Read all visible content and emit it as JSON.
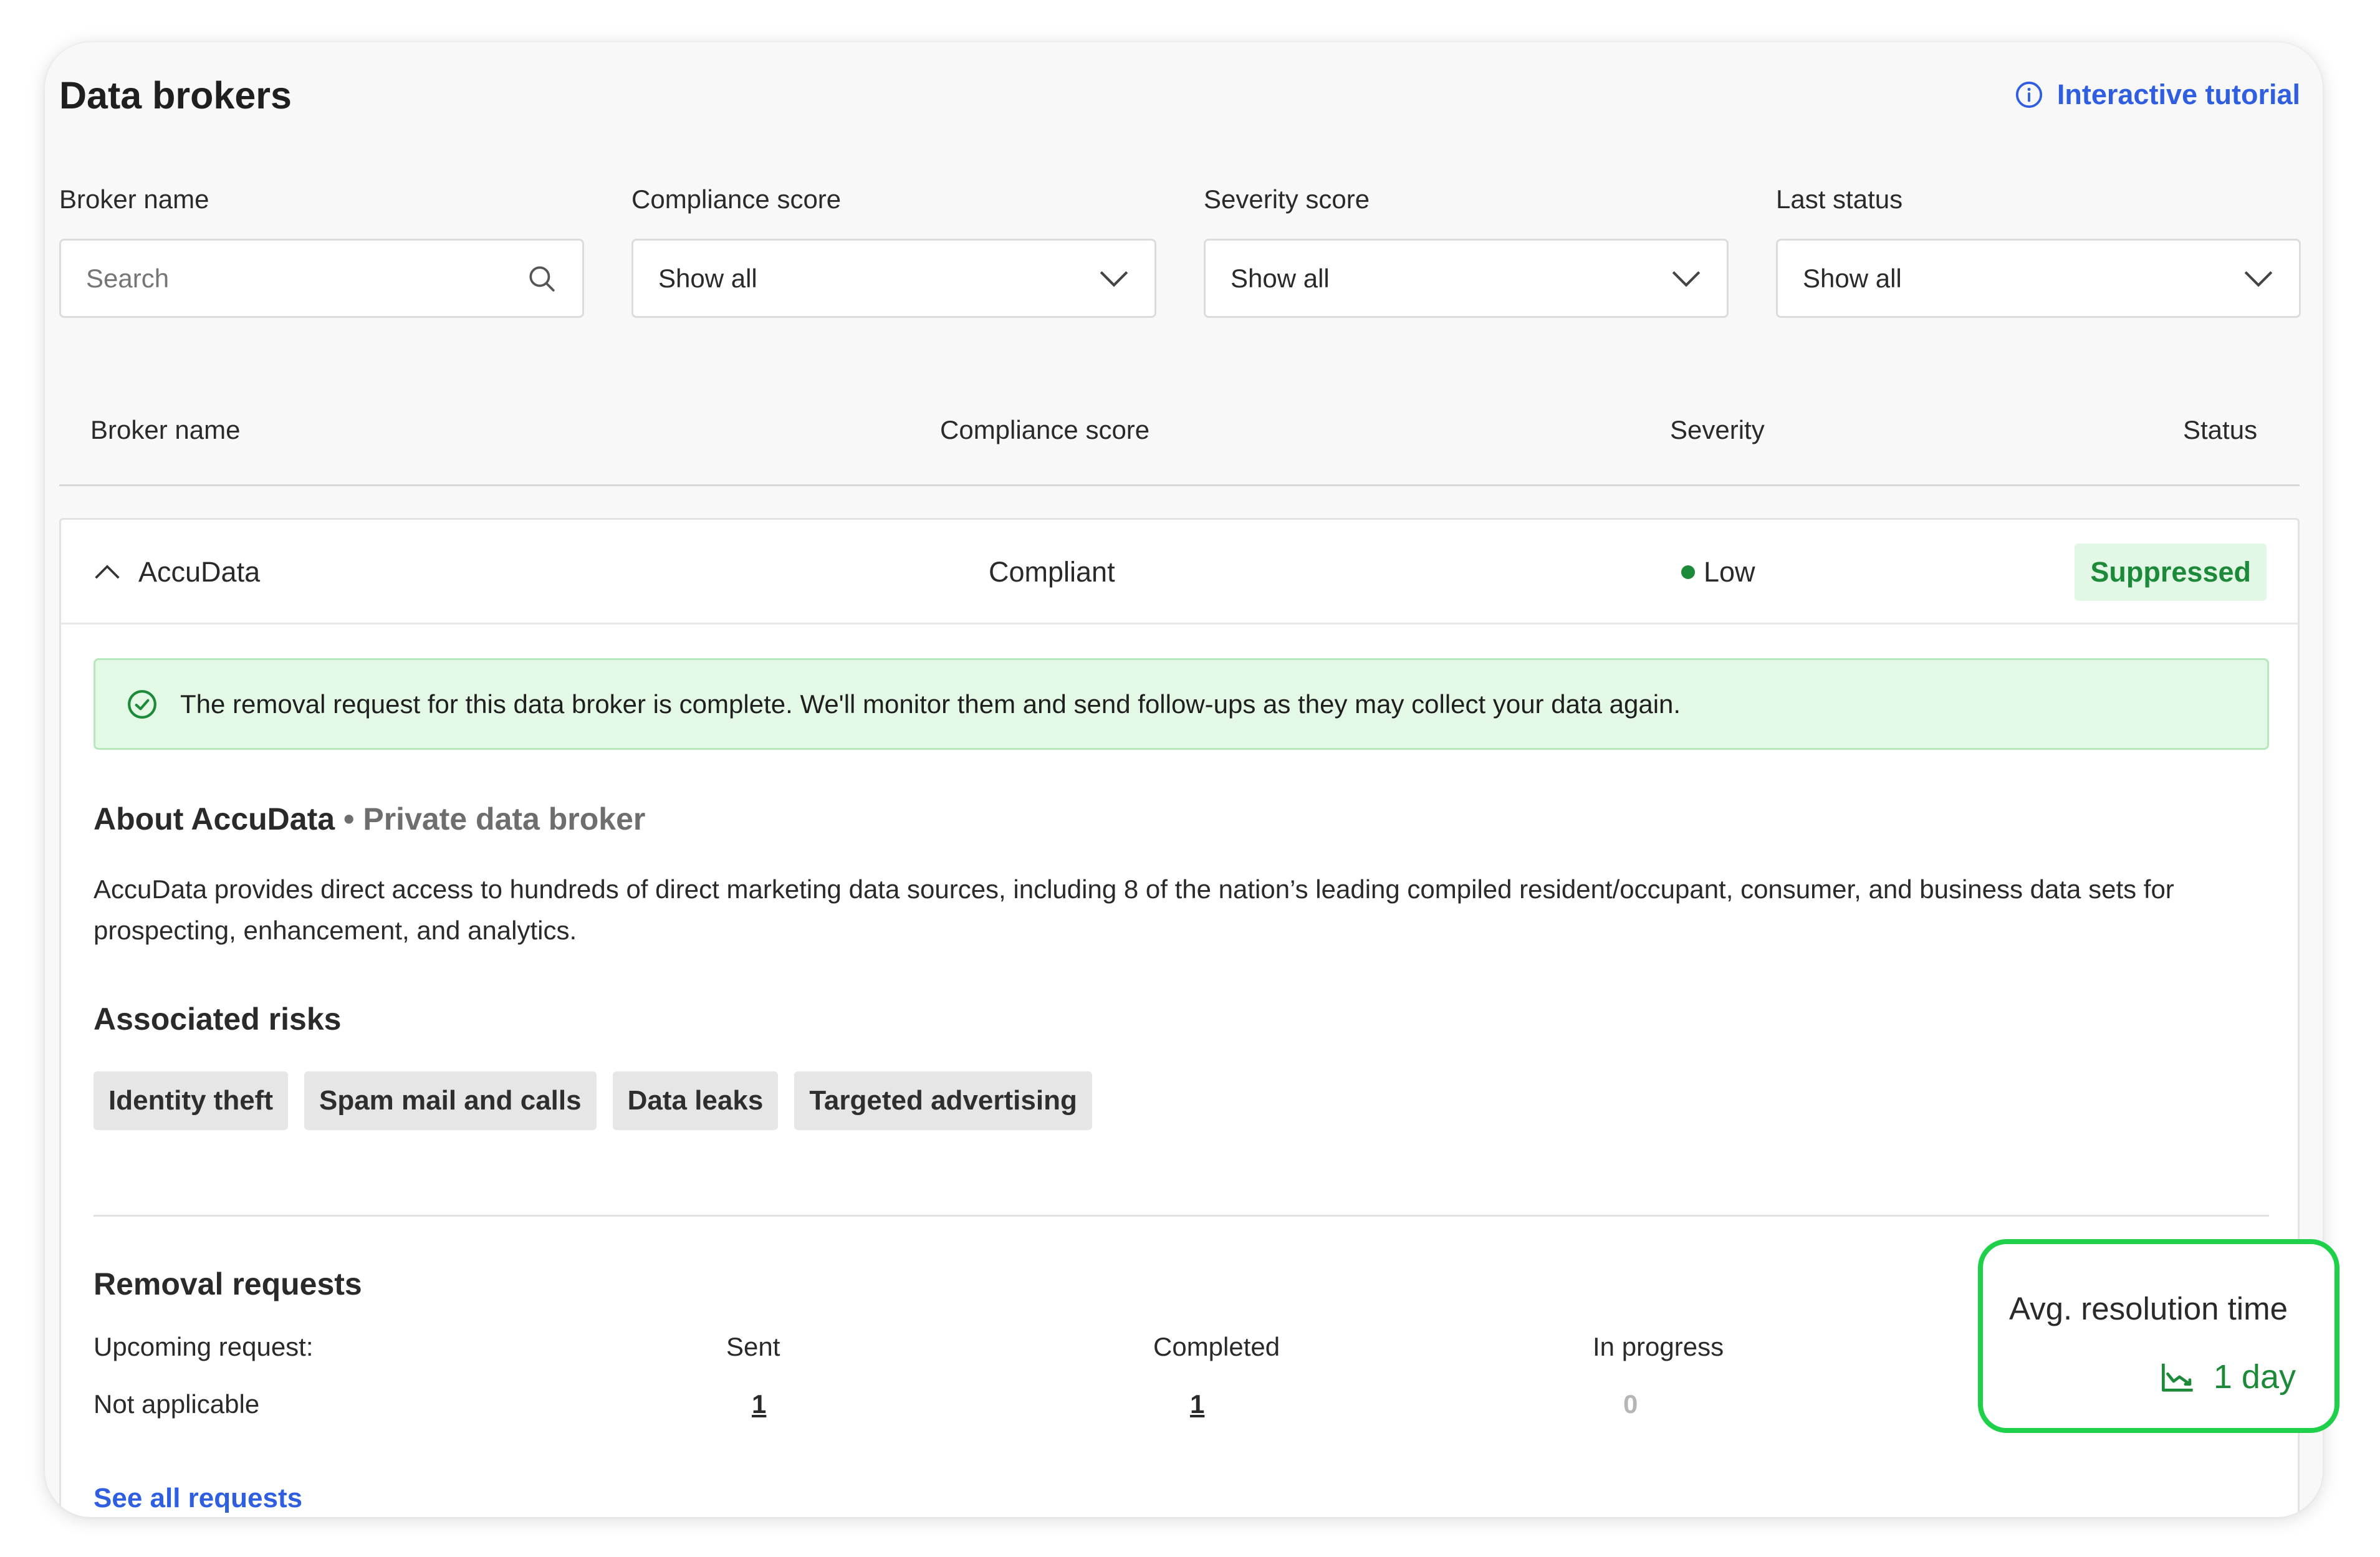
{
  "header": {
    "title": "Data brokers",
    "tutorial_label": "Interactive tutorial"
  },
  "filters": {
    "broker_name": {
      "label": "Broker name",
      "placeholder": "Search"
    },
    "compliance": {
      "label": "Compliance score",
      "value": "Show all"
    },
    "severity": {
      "label": "Severity score",
      "value": "Show all"
    },
    "status": {
      "label": "Last status",
      "value": "Show all"
    }
  },
  "table": {
    "columns": [
      "Broker name",
      "Compliance score",
      "Severity",
      "Status"
    ],
    "row": {
      "name": "AccuData",
      "compliance": "Compliant",
      "severity": "Low",
      "status": "Suppressed"
    }
  },
  "detail": {
    "alert": "The removal request for this data broker is complete. We'll monitor them and send follow-ups as they may collect your data again.",
    "about_title": "About AccuData",
    "about_subtitle": "• Private data broker",
    "about_desc": "AccuData provides direct access to hundreds of direct marketing data sources, including 8 of the nation’s leading compiled resident/occupant, consumer, and business data sets for prospecting, enhancement, and analytics.",
    "risks_title": "Associated risks",
    "risks": [
      "Identity theft",
      "Spam mail and calls",
      "Data leaks",
      "Targeted advertising"
    ],
    "removal": {
      "title": "Removal requests",
      "upcoming_label": "Upcoming request:",
      "upcoming_value": "Not applicable",
      "sent_label": "Sent",
      "sent_value": "1",
      "completed_label": "Completed",
      "completed_value": "1",
      "in_progress_label": "In progress",
      "in_progress_value": "0",
      "see_all": "See all requests"
    },
    "avg": {
      "label": "Avg. resolution time",
      "value": "1 day"
    }
  },
  "colors": {
    "accent_blue": "#2f5fe0",
    "success_green": "#1d8a3a",
    "highlight_green": "#1fd04a"
  }
}
